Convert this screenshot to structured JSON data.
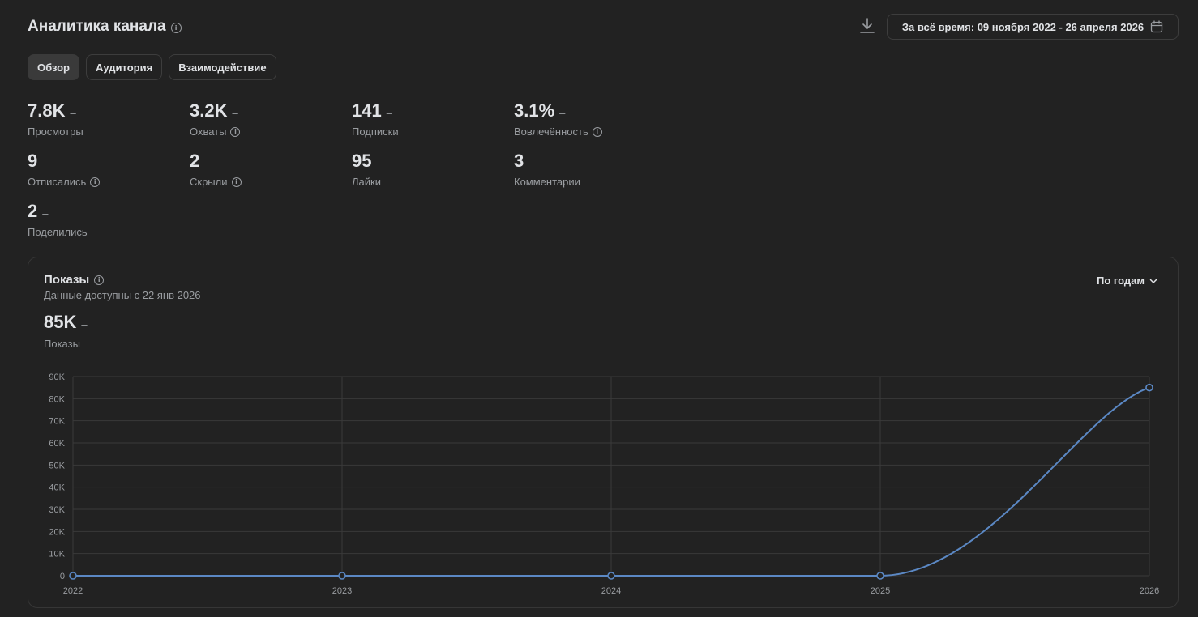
{
  "header": {
    "title": "Аналитика канала",
    "date_range": "За всё время: 09 ноября 2022 - 26 апреля 2026"
  },
  "tabs": [
    {
      "label": "Обзор",
      "active": true
    },
    {
      "label": "Аудитория",
      "active": false
    },
    {
      "label": "Взаимодействие",
      "active": false
    }
  ],
  "metrics": [
    {
      "value": "7.8K",
      "change": "–",
      "label": "Просмотры",
      "info": false
    },
    {
      "value": "3.2K",
      "change": "–",
      "label": "Охваты",
      "info": true
    },
    {
      "value": "141",
      "change": "–",
      "label": "Подписки",
      "info": false
    },
    {
      "value": "3.1%",
      "change": "–",
      "label": "Вовлечённость",
      "info": true
    },
    {
      "value": "9",
      "change": "–",
      "label": "Отписались",
      "info": true
    },
    {
      "value": "2",
      "change": "–",
      "label": "Скрыли",
      "info": true
    },
    {
      "value": "95",
      "change": "–",
      "label": "Лайки",
      "info": false
    },
    {
      "value": "3",
      "change": "–",
      "label": "Комментарии",
      "info": false
    },
    {
      "value": "2",
      "change": "–",
      "label": "Поделились",
      "info": false
    }
  ],
  "impressions_card": {
    "title": "Показы",
    "subtitle": "Данные доступны с 22 янв 2026",
    "value": "85K",
    "change": "–",
    "value_label": "Показы",
    "period": "По годам"
  },
  "colors": {
    "background": "#222222",
    "line": "#5b88c4",
    "grid": "#3a3a3a",
    "text_secondary": "#9a9da1"
  },
  "chart_data": {
    "type": "line",
    "x": [
      "2022",
      "2023",
      "2024",
      "2025",
      "2026"
    ],
    "series": [
      {
        "values": [
          0,
          0,
          0,
          0,
          85000
        ]
      }
    ],
    "ylim": [
      0,
      90000
    ],
    "yticks": [
      0,
      10000,
      20000,
      30000,
      40000,
      50000,
      60000,
      70000,
      80000,
      90000
    ],
    "ytick_labels": [
      "0",
      "10K",
      "20K",
      "30K",
      "40K",
      "50K",
      "60K",
      "70K",
      "80K",
      "90K"
    ],
    "grid": true
  }
}
